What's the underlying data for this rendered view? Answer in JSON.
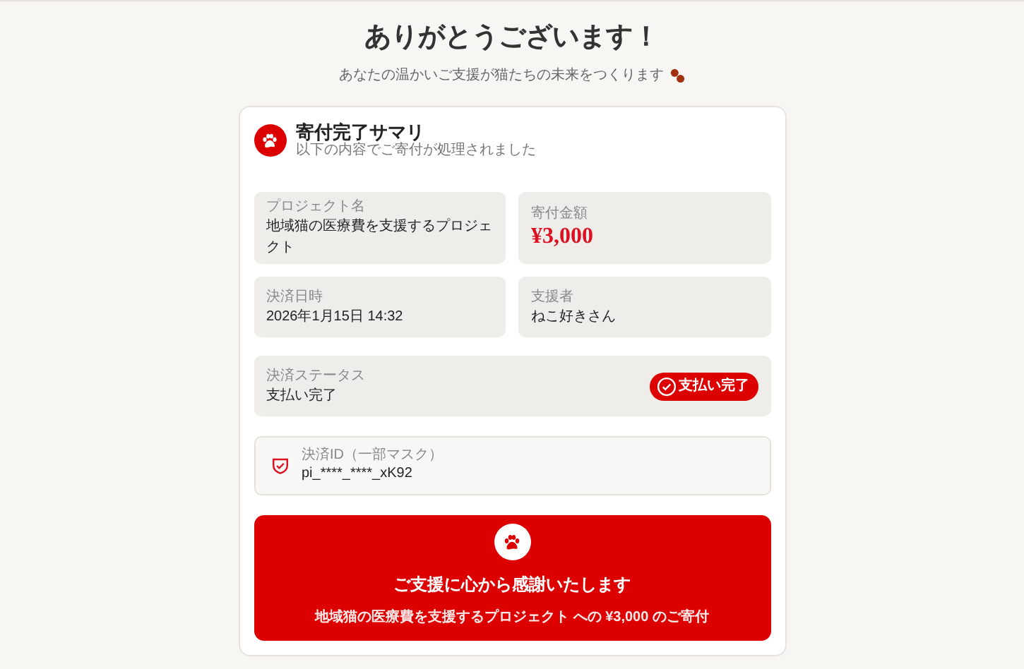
{
  "page": {
    "title": "ありがとうございます！",
    "subtitle": "あなたの温かいご支援が猫たちの未来をつくります"
  },
  "summary": {
    "title": "寄付完了サマリ",
    "subtitle": "以下の内容でご寄付が処理されました",
    "fields": [
      {
        "label": "プロジェクト名",
        "value": "地域猫の医療費を支援するプロジェクト",
        "kind": "text"
      },
      {
        "label": "寄付金額",
        "value": "¥3,000",
        "kind": "amount"
      },
      {
        "label": "決済日時",
        "value": "2026年1月15日 14:32",
        "kind": "text"
      },
      {
        "label": "支援者",
        "value": "ねこ好きさん",
        "kind": "text"
      }
    ],
    "status": {
      "label": "決済ステータス",
      "value": "支払い完了",
      "badge": "支払い完了"
    },
    "payment_id": {
      "label": "決済ID（一部マスク）",
      "value": "pi_****_****_xK92"
    },
    "thanks": {
      "title": "ご支援に心から感謝いたします",
      "message": "地域猫の医療費を支援するプロジェクト への ¥3,000 のご寄付"
    }
  }
}
